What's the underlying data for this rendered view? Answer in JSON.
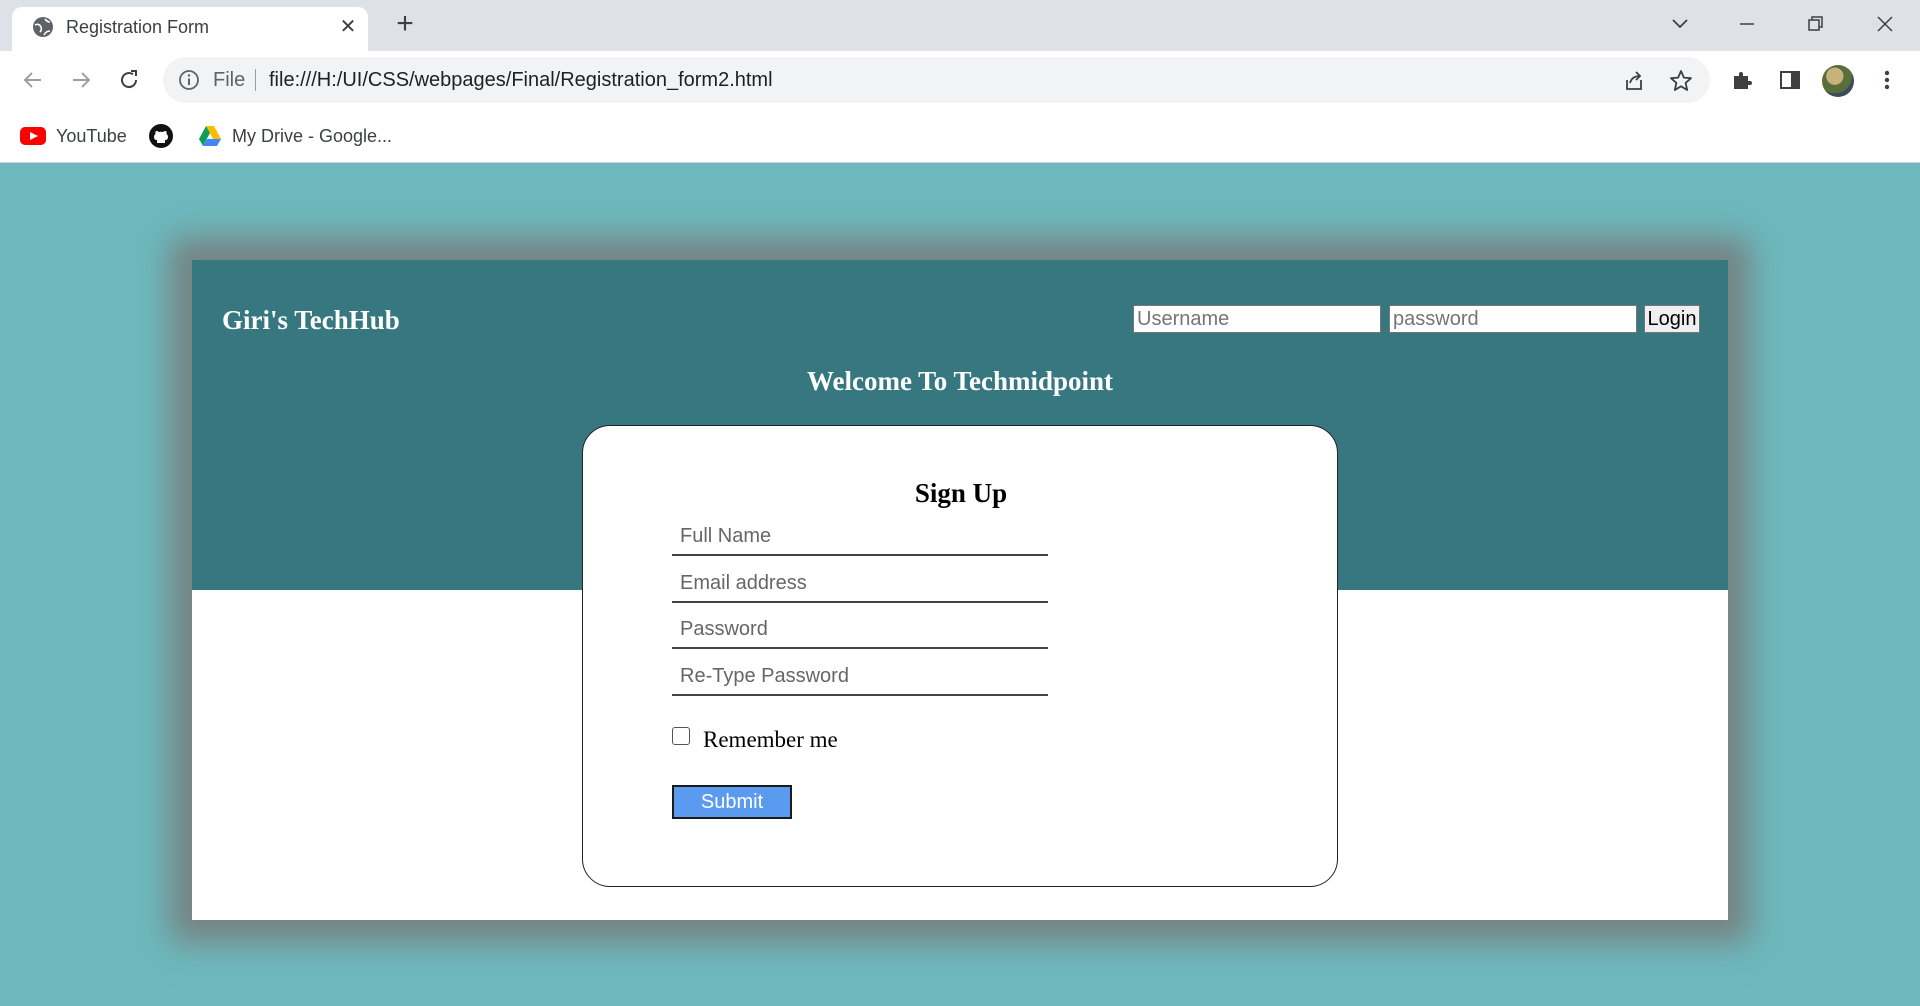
{
  "browser": {
    "tab_title": "Registration Form",
    "omnibox": {
      "scheme_label": "File",
      "url": "file:///H:/UI/CSS/webpages/Final/Registration_form2.html"
    },
    "bookmarks": [
      {
        "label": "YouTube",
        "icon": "youtube-icon"
      },
      {
        "label": "",
        "icon": "github-icon"
      },
      {
        "label": "My Drive - Google...",
        "icon": "google-drive-icon"
      }
    ]
  },
  "page": {
    "brand": "Giri's TechHub",
    "login": {
      "username_placeholder": "Username",
      "password_placeholder": "password",
      "button_label": "Login"
    },
    "welcome": "Welcome To Techmidpoint",
    "signup": {
      "title": "Sign Up",
      "fields": [
        {
          "placeholder": "Full Name"
        },
        {
          "placeholder": "Email address"
        },
        {
          "placeholder": "Password"
        },
        {
          "placeholder": "Re-Type Password"
        }
      ],
      "remember_label": "Remember me",
      "remember_checked": false,
      "submit_label": "Submit"
    }
  },
  "colors": {
    "page_background": "#6db9bd",
    "header_background": "#367780",
    "submit_button": "#5b9bef"
  }
}
